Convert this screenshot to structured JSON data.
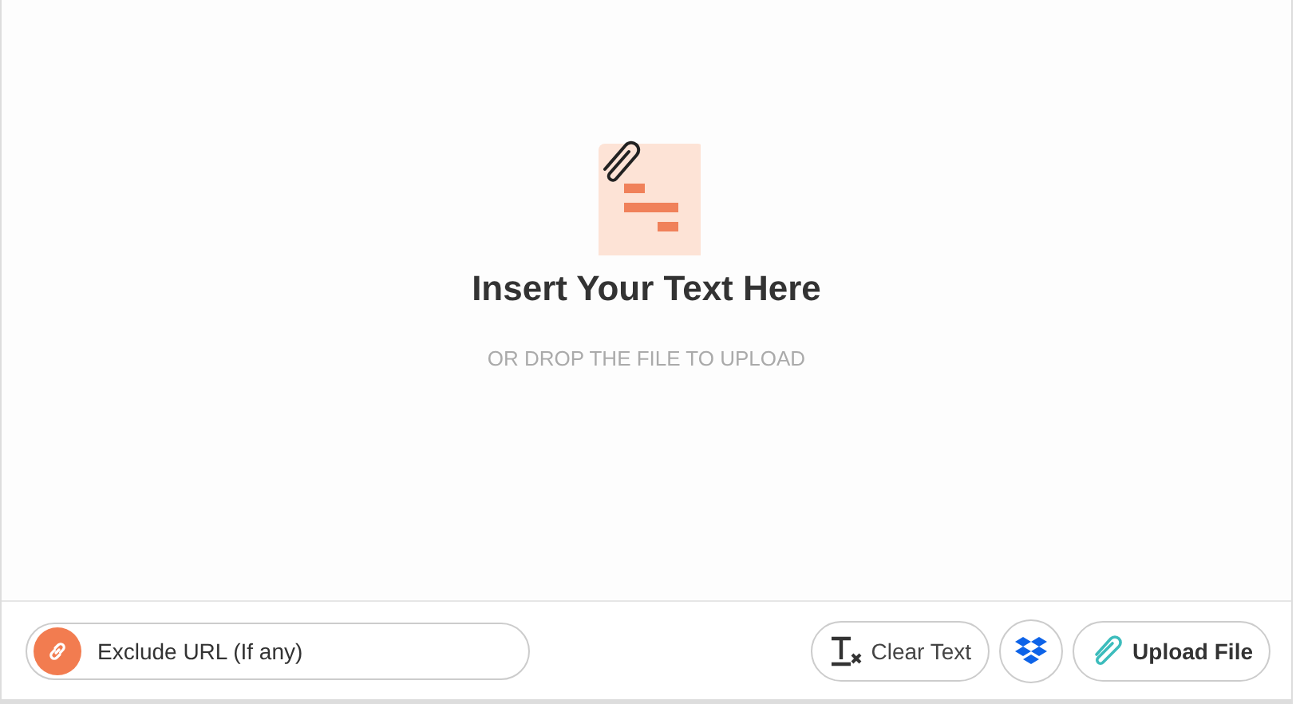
{
  "drop_area": {
    "title": "Insert Your Text Here",
    "subtitle": "OR DROP THE FILE TO UPLOAD"
  },
  "toolbar": {
    "exclude_url": {
      "placeholder": "Exclude URL (If any)"
    },
    "clear_button": "Clear Text",
    "upload_button": "Upload File"
  }
}
